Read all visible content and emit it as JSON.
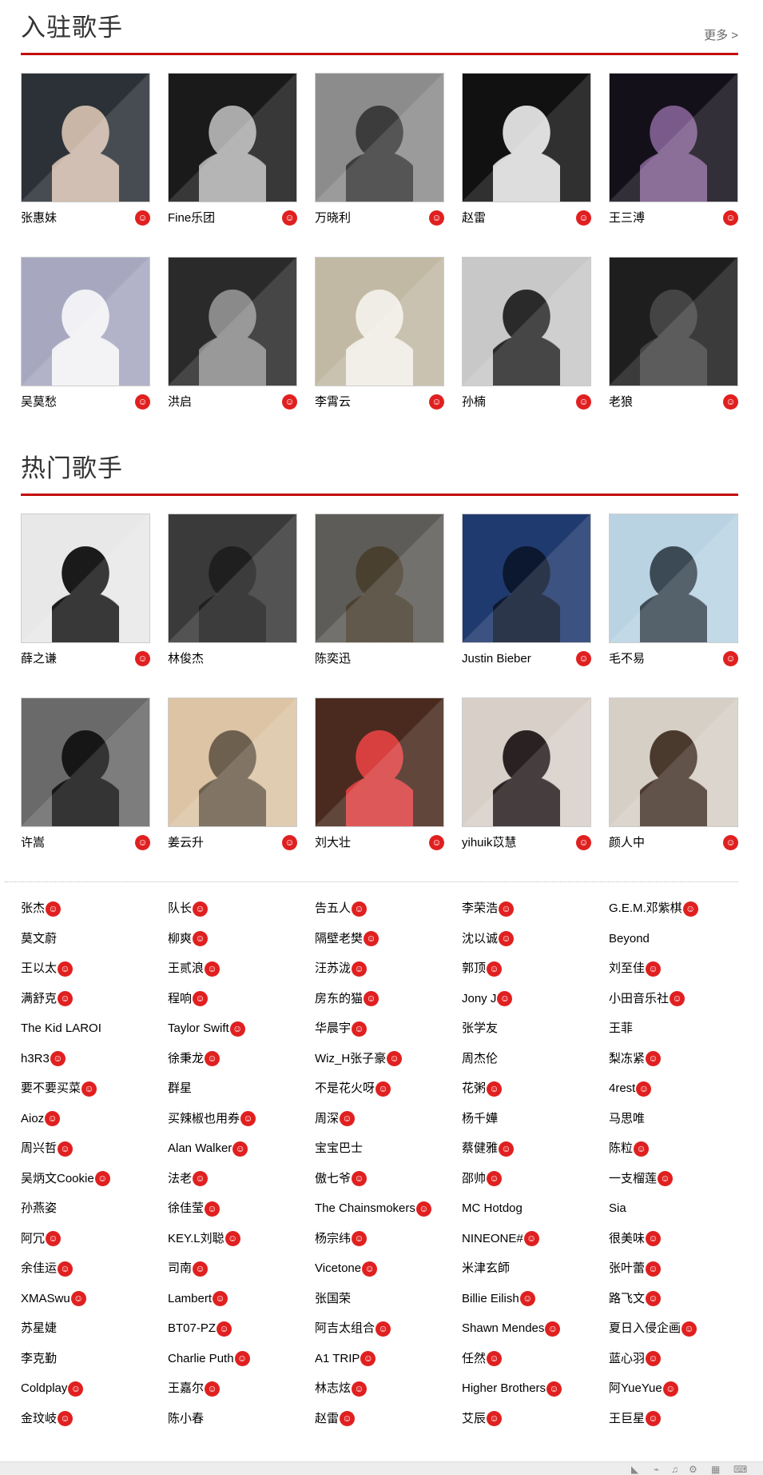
{
  "sections": [
    {
      "title": "入驻歌手",
      "more": "更多 >",
      "cards": [
        {
          "name": "张惠妹",
          "badge": true,
          "bg": "#2c3138",
          "fg": "#c9b6a6"
        },
        {
          "name": "Fine乐团",
          "badge": true,
          "bg": "#1a1a1a",
          "fg": "#aaaaaa"
        },
        {
          "name": "万晓利",
          "badge": true,
          "bg": "#8c8c8c",
          "fg": "#3c3c3c"
        },
        {
          "name": "赵雷",
          "badge": true,
          "bg": "#111111",
          "fg": "#d8d8d8"
        },
        {
          "name": "王三溥",
          "badge": true,
          "bg": "#14101a",
          "fg": "#7a5a8a"
        },
        {
          "name": "吴莫愁",
          "badge": true,
          "bg": "#a7a8c0",
          "fg": "#f1f1f5"
        },
        {
          "name": "洪启",
          "badge": true,
          "bg": "#2a2a2a",
          "fg": "#8a8a8a"
        },
        {
          "name": "李霄云",
          "badge": true,
          "bg": "#c2b9a4",
          "fg": "#f0ede6"
        },
        {
          "name": "孙楠",
          "badge": true,
          "bg": "#c8c8c8",
          "fg": "#2a2a2a"
        },
        {
          "name": "老狼",
          "badge": true,
          "bg": "#1e1e1e",
          "fg": "#444444"
        }
      ]
    },
    {
      "title": "热门歌手",
      "more": "",
      "cards": [
        {
          "name": "薛之谦",
          "badge": true,
          "bg": "#e8e8e8",
          "fg": "#1a1a1a"
        },
        {
          "name": "林俊杰",
          "badge": false,
          "bg": "#3a3a3a",
          "fg": "#1f1f1f"
        },
        {
          "name": "陈奕迅",
          "badge": false,
          "bg": "#5e5c58",
          "fg": "#4a4030"
        },
        {
          "name": "Justin Bieber",
          "badge": true,
          "bg": "#1f3a6e",
          "fg": "#0c1830"
        },
        {
          "name": "毛不易",
          "badge": true,
          "bg": "#b9d3e3",
          "fg": "#3c4a55"
        },
        {
          "name": "许嵩",
          "badge": true,
          "bg": "#6a6a6a",
          "fg": "#161616"
        },
        {
          "name": "姜云升",
          "badge": true,
          "bg": "#dcc4a4",
          "fg": "#6e604e"
        },
        {
          "name": "刘大壮",
          "badge": true,
          "bg": "#4a2a1e",
          "fg": "#d84040"
        },
        {
          "name": "yihuik苡慧",
          "badge": true,
          "bg": "#d8cfc8",
          "fg": "#2a2222"
        },
        {
          "name": "颜人中",
          "badge": true,
          "bg": "#d6cfc6",
          "fg": "#4a3a2e"
        }
      ]
    }
  ],
  "artist_list": [
    [
      {
        "name": "张杰",
        "badge": true
      },
      {
        "name": "队长",
        "badge": true
      },
      {
        "name": "告五人",
        "badge": true
      },
      {
        "name": "李荣浩",
        "badge": true
      },
      {
        "name": "G.E.M.邓紫棋",
        "badge": true
      }
    ],
    [
      {
        "name": "莫文蔚",
        "badge": false
      },
      {
        "name": "柳爽",
        "badge": true
      },
      {
        "name": "隔壁老樊",
        "badge": true
      },
      {
        "name": "沈以诚",
        "badge": true
      },
      {
        "name": "Beyond",
        "badge": false
      }
    ],
    [
      {
        "name": "王以太",
        "badge": true
      },
      {
        "name": "王贰浪",
        "badge": true
      },
      {
        "name": "汪苏泷",
        "badge": true
      },
      {
        "name": "郭顶",
        "badge": true
      },
      {
        "name": "刘至佳",
        "badge": true
      }
    ],
    [
      {
        "name": "满舒克",
        "badge": true
      },
      {
        "name": "程响",
        "badge": true
      },
      {
        "name": "房东的猫",
        "badge": true
      },
      {
        "name": "Jony J",
        "badge": true
      },
      {
        "name": "小田音乐社",
        "badge": true
      }
    ],
    [
      {
        "name": "The Kid LAROI",
        "badge": false
      },
      {
        "name": "Taylor Swift",
        "badge": true
      },
      {
        "name": "华晨宇",
        "badge": true
      },
      {
        "name": "张学友",
        "badge": false
      },
      {
        "name": "王菲",
        "badge": false
      }
    ],
    [
      {
        "name": "h3R3",
        "badge": true
      },
      {
        "name": "徐秉龙",
        "badge": true
      },
      {
        "name": "Wiz_H张子豪",
        "badge": true
      },
      {
        "name": "周杰伦",
        "badge": false
      },
      {
        "name": "梨冻紧",
        "badge": true
      }
    ],
    [
      {
        "name": "要不要买菜",
        "badge": true
      },
      {
        "name": "群星",
        "badge": false
      },
      {
        "name": "不是花火呀",
        "badge": true
      },
      {
        "name": "花粥",
        "badge": true
      },
      {
        "name": "4rest",
        "badge": true
      }
    ],
    [
      {
        "name": "Aioz",
        "badge": true
      },
      {
        "name": "买辣椒也用券",
        "badge": true
      },
      {
        "name": "周深",
        "badge": true
      },
      {
        "name": "杨千嬅",
        "badge": false
      },
      {
        "name": "马思唯",
        "badge": false
      }
    ],
    [
      {
        "name": "周兴哲",
        "badge": true
      },
      {
        "name": "Alan Walker",
        "badge": true
      },
      {
        "name": "宝宝巴士",
        "badge": false
      },
      {
        "name": "蔡健雅",
        "badge": true
      },
      {
        "name": "陈粒",
        "badge": true
      }
    ],
    [
      {
        "name": "吴炳文Cookie",
        "badge": true
      },
      {
        "name": "法老",
        "badge": true
      },
      {
        "name": "傲七爷",
        "badge": true
      },
      {
        "name": "邵帅",
        "badge": true
      },
      {
        "name": "一支榴莲",
        "badge": true
      }
    ],
    [
      {
        "name": "孙燕姿",
        "badge": false
      },
      {
        "name": "徐佳莹",
        "badge": true
      },
      {
        "name": "The Chainsmokers",
        "badge": true
      },
      {
        "name": "MC Hotdog",
        "badge": false
      },
      {
        "name": "Sia",
        "badge": false
      }
    ],
    [
      {
        "name": "阿冗",
        "badge": true
      },
      {
        "name": "KEY.L刘聪",
        "badge": true
      },
      {
        "name": "杨宗纬",
        "badge": true
      },
      {
        "name": "NINEONE#",
        "badge": true
      },
      {
        "name": "很美味",
        "badge": true
      }
    ],
    [
      {
        "name": "余佳运",
        "badge": true
      },
      {
        "name": "司南",
        "badge": true
      },
      {
        "name": "Vicetone",
        "badge": true
      },
      {
        "name": "米津玄師",
        "badge": false
      },
      {
        "name": "张叶蕾",
        "badge": true
      }
    ],
    [
      {
        "name": "XMASwu",
        "badge": true
      },
      {
        "name": "Lambert",
        "badge": true
      },
      {
        "name": "张国荣",
        "badge": false
      },
      {
        "name": "Billie Eilish",
        "badge": true
      },
      {
        "name": "路飞文",
        "badge": true
      }
    ],
    [
      {
        "name": "苏星婕",
        "badge": false
      },
      {
        "name": "BT07-PZ",
        "badge": true
      },
      {
        "name": "阿吉太组合",
        "badge": true
      },
      {
        "name": "Shawn Mendes",
        "badge": true
      },
      {
        "name": "夏日入侵企画",
        "badge": true
      }
    ],
    [
      {
        "name": "李克勤",
        "badge": false
      },
      {
        "name": "Charlie Puth",
        "badge": true
      },
      {
        "name": "A1 TRIP",
        "badge": true
      },
      {
        "name": "任然",
        "badge": true
      },
      {
        "name": "蓝心羽",
        "badge": true
      }
    ],
    [
      {
        "name": "Coldplay",
        "badge": true
      },
      {
        "name": "王嘉尔",
        "badge": true
      },
      {
        "name": "林志炫",
        "badge": true
      },
      {
        "name": "Higher Brothers",
        "badge": true
      },
      {
        "name": "阿YueYue",
        "badge": true
      }
    ],
    [
      {
        "name": "金玟岐",
        "badge": true
      },
      {
        "name": "陈小春",
        "badge": false
      },
      {
        "name": "赵雷",
        "badge": true
      },
      {
        "name": "艾辰",
        "badge": true
      },
      {
        "name": "王巨星",
        "badge": true
      }
    ]
  ],
  "colors": {
    "accent": "#c20c0c",
    "badge": "#e02020"
  }
}
